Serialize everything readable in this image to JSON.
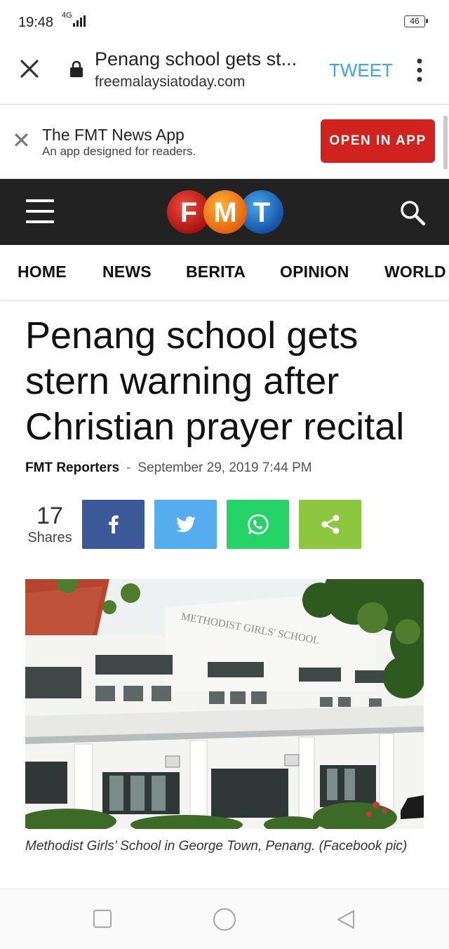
{
  "status_bar": {
    "time": "19:48",
    "network": "4G",
    "battery": "46"
  },
  "browser": {
    "page_title": "Penang school gets st...",
    "domain": "freemalaysiatoday.com",
    "tweet_label": "TWEET"
  },
  "app_banner": {
    "app_name": "The FMT News App",
    "tagline": "An app designed for readers.",
    "open_label": "OPEN IN APP"
  },
  "header": {
    "logo_letters": [
      "F",
      "M",
      "T"
    ]
  },
  "nav": {
    "items": [
      "HOME",
      "NEWS",
      "BERITA",
      "OPINION",
      "WORLD"
    ]
  },
  "article": {
    "headline": "Penang school gets stern warning after Christian prayer recital",
    "author": "FMT Reporters",
    "separator": "-",
    "date": "September 29, 2019 7:44 PM",
    "share_count": "17",
    "shares_label": "Shares",
    "share_buttons": [
      {
        "name": "facebook",
        "color": "#3b5998",
        "icon": "facebook-icon"
      },
      {
        "name": "twitter",
        "color": "#55acee",
        "icon": "twitter-icon"
      },
      {
        "name": "whatsapp",
        "color": "#25d366",
        "icon": "whatsapp-icon"
      },
      {
        "name": "share",
        "color": "#8dc63f",
        "icon": "share-icon"
      }
    ],
    "image_sign": "METHODIST GIRLS' SCHOOL",
    "caption": "Methodist Girls’ School in George Town, Penang. (Facebook pic)"
  },
  "colors": {
    "tweet": "#3ba6e8",
    "open_button": "#d0231f",
    "header_bg": "#222222"
  }
}
